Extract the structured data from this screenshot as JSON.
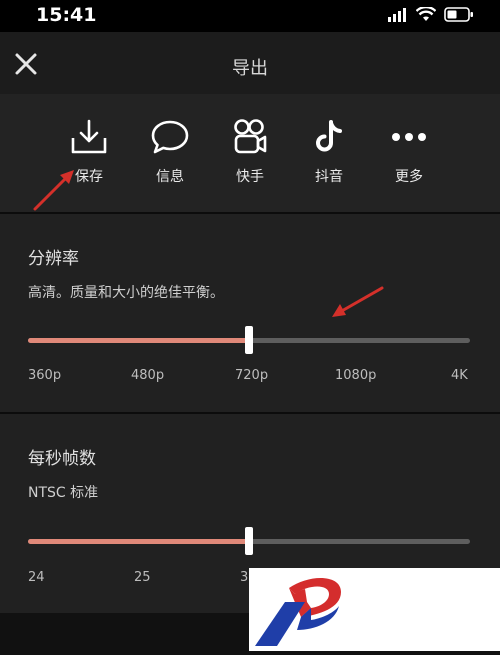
{
  "status": {
    "time": "15:41"
  },
  "header": {
    "title": "导出"
  },
  "share": {
    "items": [
      {
        "label": "保存",
        "icon": "download-icon"
      },
      {
        "label": "信息",
        "icon": "chat-bubble-icon"
      },
      {
        "label": "快手",
        "icon": "kuaishou-icon"
      },
      {
        "label": "抖音",
        "icon": "tiktok-icon"
      },
      {
        "label": "更多",
        "icon": "more-dots-icon"
      }
    ]
  },
  "resolution": {
    "title": "分辨率",
    "subtitle": "高清。质量和大小的绝佳平衡。",
    "ticks": [
      "360p",
      "480p",
      "720p",
      "1080p",
      "4K"
    ],
    "selected": "720p",
    "value_fraction": 0.5
  },
  "framerate": {
    "title": "每秒帧数",
    "subtitle": "NTSC 标准",
    "ticks": [
      "24",
      "25",
      "3"
    ],
    "value_fraction": 0.5
  },
  "colors": {
    "accent": "#e08979",
    "track": "#5e5e5e",
    "arrow": "#d4302a"
  }
}
